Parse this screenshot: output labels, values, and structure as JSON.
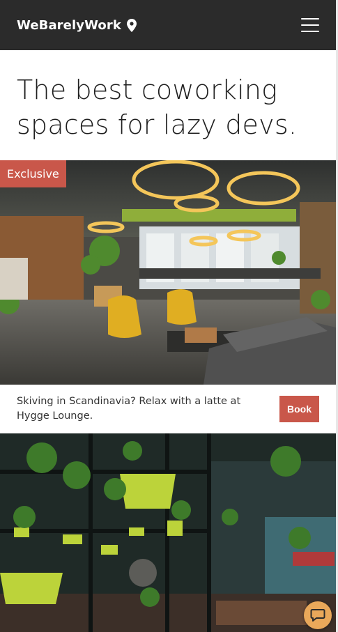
{
  "header": {
    "brand": "WeBarelyWork",
    "pin_icon": "map-pin-icon",
    "menu_icon": "hamburger-menu-icon"
  },
  "hero": {
    "title": "The best coworking spaces for lazy devs."
  },
  "featured": {
    "badge": "Exclusive",
    "caption": "Skiving in Scandinavia? Relax with a latte at Hygge Lounge.",
    "book_label": "Book"
  },
  "chat": {
    "icon": "chat-bubble-icon"
  },
  "colors": {
    "header_bg": "#2b2b2b",
    "accent": "#c9574a",
    "chat": "#e9a85a"
  }
}
